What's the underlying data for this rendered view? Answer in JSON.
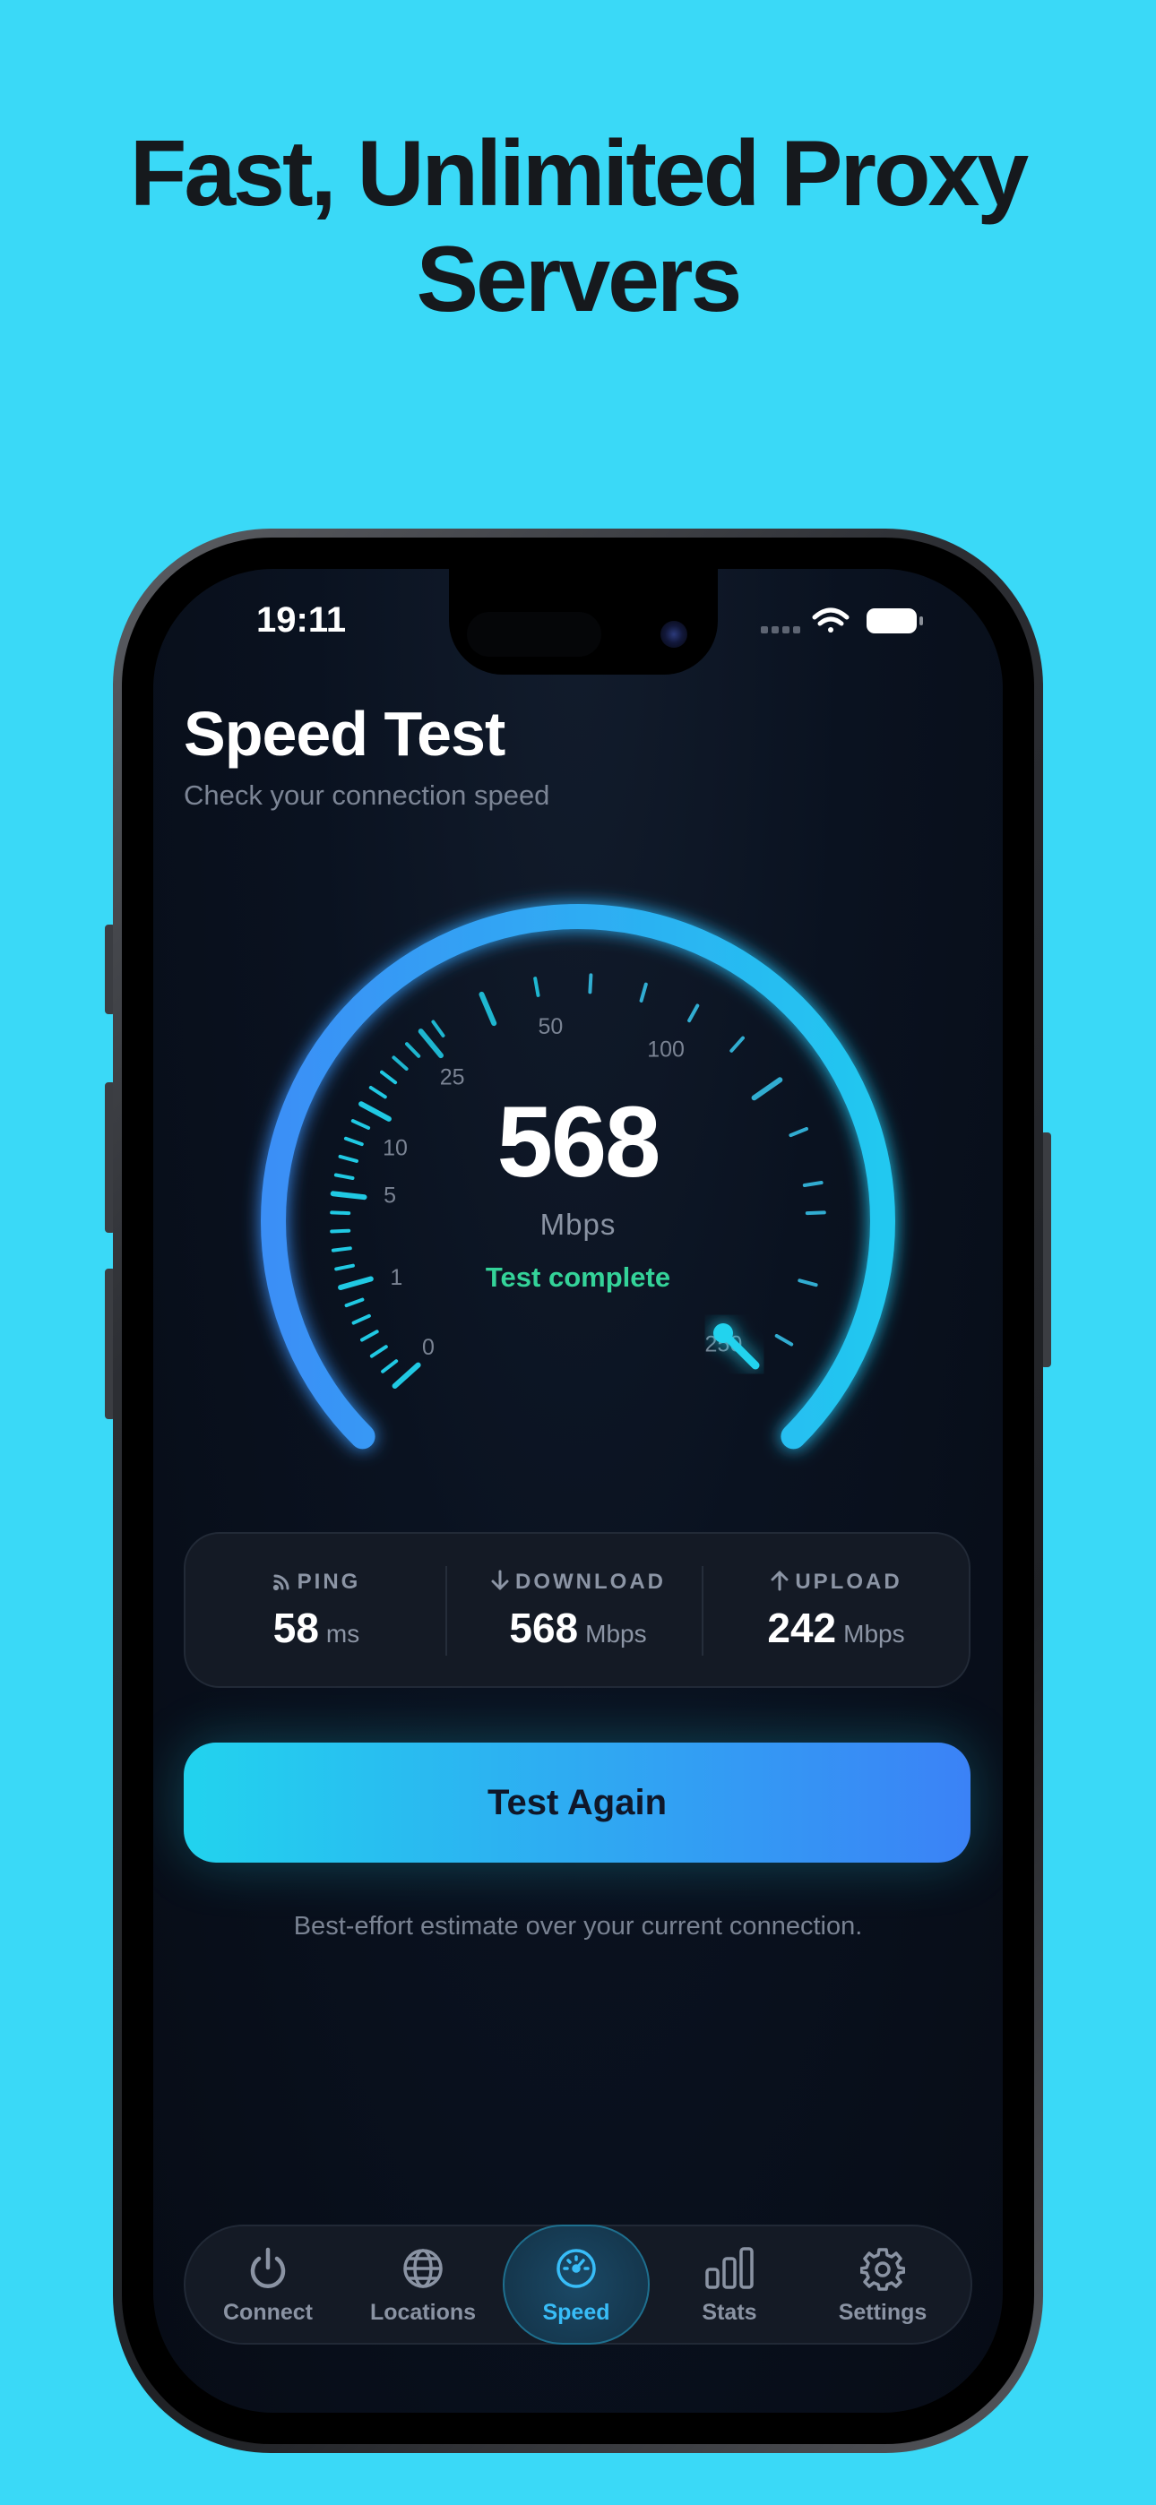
{
  "headline": {
    "line1": "Fast, Unlimited Proxy",
    "line2": "Servers"
  },
  "status_bar": {
    "time": "19:11",
    "icons": [
      "cellular-icon",
      "wifi-icon",
      "battery-icon"
    ]
  },
  "screen": {
    "title": "Speed Test",
    "subtitle": "Check your connection speed"
  },
  "gauge": {
    "value": "568",
    "unit": "Mbps",
    "status": "Test complete",
    "scale_labels": [
      "0",
      "1",
      "5",
      "10",
      "25",
      "50",
      "100",
      "250"
    ],
    "needle_at_label": "250",
    "colors": {
      "arc_start": "#3b82f6",
      "arc_end": "#22d3ee",
      "status": "#34d399"
    }
  },
  "stats": [
    {
      "label": "PING",
      "icon": "signal-icon",
      "value": "58",
      "unit": "ms"
    },
    {
      "label": "DOWNLOAD",
      "icon": "arrow-down-icon",
      "value": "568",
      "unit": "Mbps"
    },
    {
      "label": "UPLOAD",
      "icon": "arrow-up-icon",
      "value": "242",
      "unit": "Mbps"
    }
  ],
  "cta": {
    "label": "Test Again"
  },
  "note": "Best-effort estimate over your current connection.",
  "tabs": [
    {
      "label": "Connect",
      "icon": "power-icon",
      "active": false
    },
    {
      "label": "Locations",
      "icon": "globe-icon",
      "active": false
    },
    {
      "label": "Speed",
      "icon": "speedometer-icon",
      "active": true
    },
    {
      "label": "Stats",
      "icon": "bar-chart-icon",
      "active": false
    },
    {
      "label": "Settings",
      "icon": "gear-icon",
      "active": false
    }
  ],
  "colors": {
    "background": "#3ad9f7",
    "accent": "#38bdf8",
    "screen_bg": "#0a1220"
  }
}
